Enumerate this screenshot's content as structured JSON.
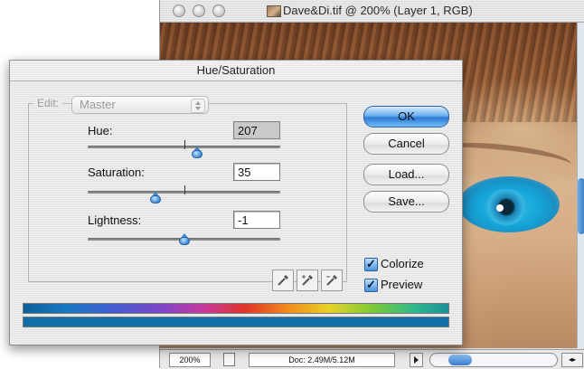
{
  "document_window": {
    "title": "Dave&Di.tif @ 200% (Layer 1, RGB)",
    "status": {
      "zoom": "200%",
      "doc_size": "Doc: 2.49M/5.12M"
    }
  },
  "dialog": {
    "title": "Hue/Saturation",
    "edit_label": "Edit:",
    "edit_value": "Master",
    "params": {
      "hue": {
        "label": "Hue:",
        "value": "207",
        "slider_fraction": 0.57
      },
      "saturation": {
        "label": "Saturation:",
        "value": "35",
        "slider_fraction": 0.35
      },
      "lightness": {
        "label": "Lightness:",
        "value": "-1",
        "slider_fraction": 0.5
      }
    },
    "buttons": {
      "ok": "OK",
      "cancel": "Cancel",
      "load": "Load...",
      "save": "Save..."
    },
    "checkboxes": {
      "colorize": {
        "label": "Colorize",
        "checked": true
      },
      "preview": {
        "label": "Preview",
        "checked": true
      }
    },
    "colors": {
      "accent": "#3d86c9",
      "colorize_tint": "#0f6fa6"
    }
  }
}
